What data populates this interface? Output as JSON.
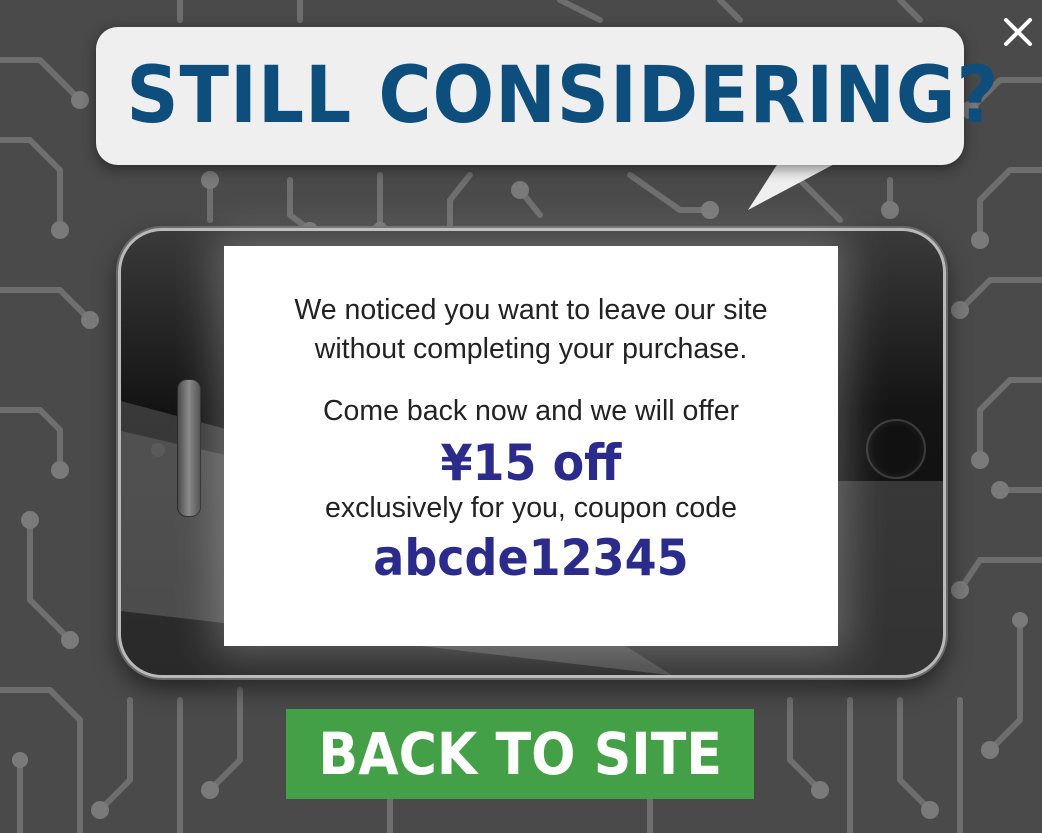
{
  "popup": {
    "headline": "STILL CONSIDERING?",
    "message_line1": "We noticed you want to leave our site",
    "message_line2": "without completing your purchase.",
    "offer_line": "Come back now and we will offer",
    "discount": "¥15 off",
    "coupon_line": "exclusively for you, coupon code",
    "coupon_code": "abcde12345",
    "back_button": "BACK TO SITE",
    "close_icon": "close-icon"
  },
  "colors": {
    "headline": "#0e4e7c",
    "highlight": "#2b2b8c",
    "button": "#43a047",
    "background": "#4a4a4a",
    "bubble": "#efefef"
  }
}
